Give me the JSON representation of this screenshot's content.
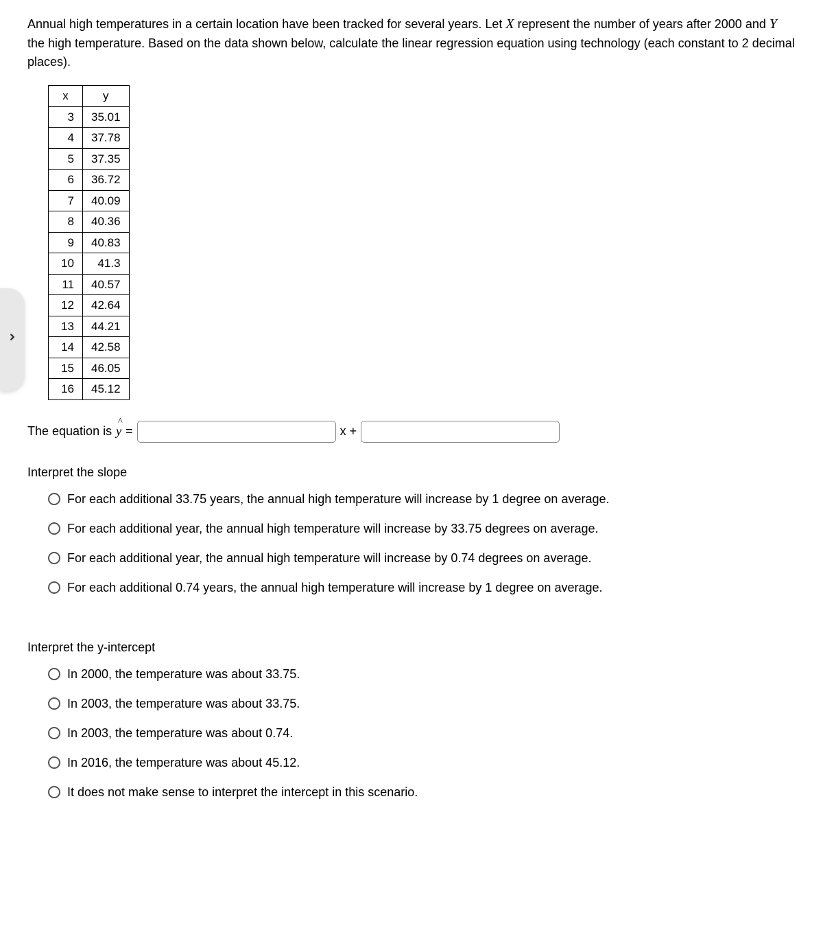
{
  "prompt": {
    "part1": "Annual high temperatures in a certain location have been tracked for several years. Let ",
    "var1": "X",
    "part2": " represent the number of years after 2000 and ",
    "var2": "Y",
    "part3": " the high temperature. Based on the data shown below, calculate the linear regression equation using technology (each constant to 2 decimal places)."
  },
  "table": {
    "headers": {
      "x": "x",
      "y": "y"
    },
    "rows": [
      {
        "x": "3",
        "y": "35.01"
      },
      {
        "x": "4",
        "y": "37.78"
      },
      {
        "x": "5",
        "y": "37.35"
      },
      {
        "x": "6",
        "y": "36.72"
      },
      {
        "x": "7",
        "y": "40.09"
      },
      {
        "x": "8",
        "y": "40.36"
      },
      {
        "x": "9",
        "y": "40.83"
      },
      {
        "x": "10",
        "y": "41.3"
      },
      {
        "x": "11",
        "y": "40.57"
      },
      {
        "x": "12",
        "y": "42.64"
      },
      {
        "x": "13",
        "y": "44.21"
      },
      {
        "x": "14",
        "y": "42.58"
      },
      {
        "x": "15",
        "y": "46.05"
      },
      {
        "x": "16",
        "y": "45.12"
      }
    ]
  },
  "equation": {
    "prefix": "The equation is ",
    "yhat": "y",
    "equals": " = ",
    "xplus": " x + "
  },
  "slope": {
    "heading": "Interpret the slope",
    "options": [
      "For each additional 33.75 years, the annual high temperature will increase by 1 degree on average.",
      "For each additional year, the annual high temperature will increase by 33.75 degrees on average.",
      "For each additional year, the annual high temperature will increase by 0.74 degrees on average.",
      "For each additional 0.74 years, the annual high temperature will increase by 1 degree on average."
    ]
  },
  "intercept": {
    "heading": "Interpret the y-intercept",
    "options": [
      "In 2000, the temperature was about 33.75.",
      "In 2003, the temperature was about 33.75.",
      "In 2003, the temperature was about 0.74.",
      "In 2016, the temperature was about 45.12.",
      "It does not make sense to interpret the intercept in this scenario."
    ]
  }
}
